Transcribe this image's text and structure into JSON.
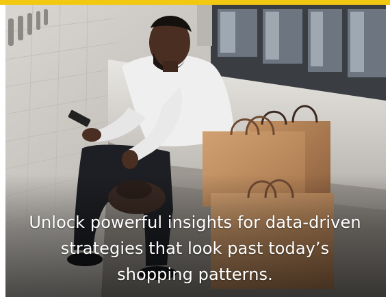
{
  "card": {
    "caption": "Unlock powerful insights for data-driven strategies that look past today’s shopping patterns."
  },
  "colors": {
    "accent_strip": "#f2c811",
    "caption_text": "#ffffff"
  },
  "image": {
    "subject": "man-with-phone-and-shopping-bags-photo"
  }
}
